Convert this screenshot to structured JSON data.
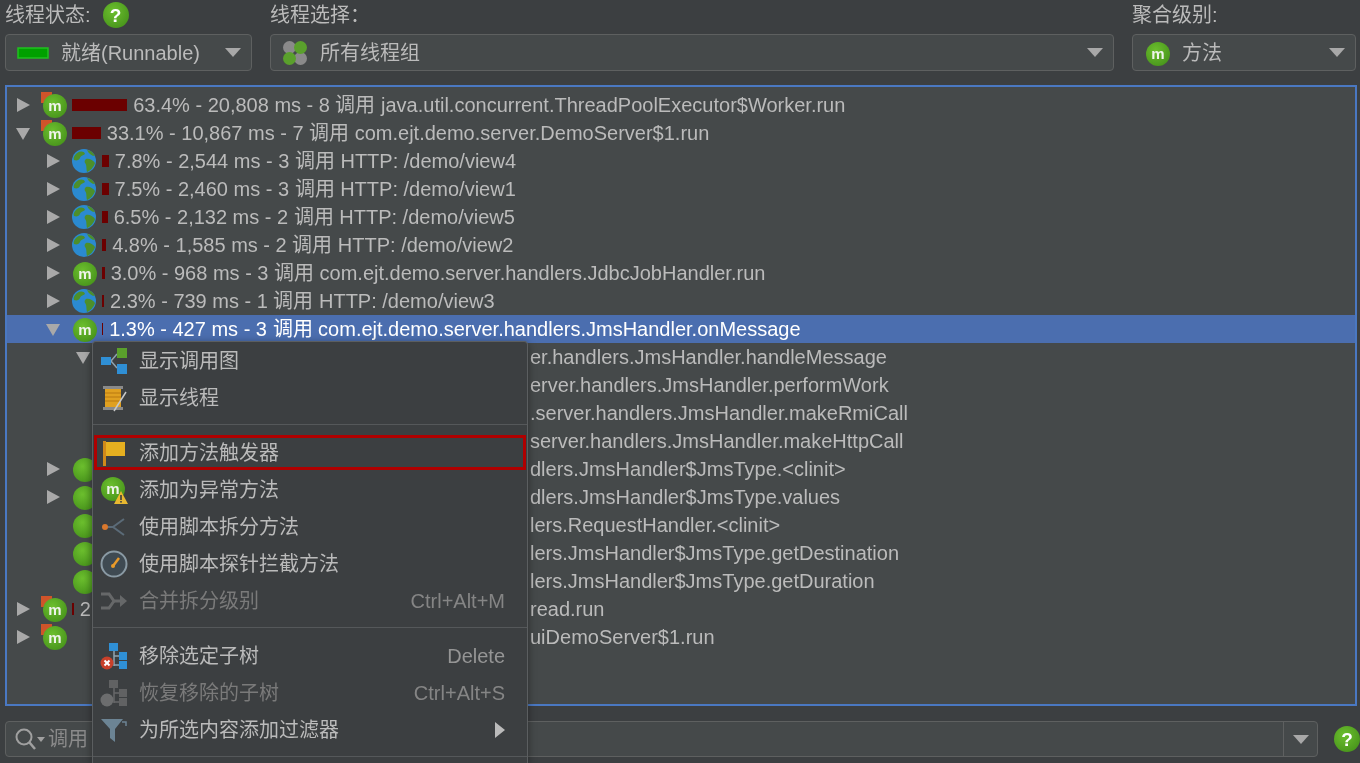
{
  "toolbar": {
    "thread_state": {
      "label": "线程状态:",
      "help": "?",
      "value": "就绪(Runnable)"
    },
    "thread_selection": {
      "label": "线程选择：",
      "value": "所有线程组"
    },
    "aggregation": {
      "label": "聚合级别:",
      "value": "方法",
      "glyph": "m"
    }
  },
  "tree": {
    "rows": [
      {
        "kind": "method",
        "glyph": "m",
        "marked": true,
        "expanded": false,
        "selected": false,
        "level": 0.634,
        "text": "63.4% - 20,808 ms - 8 调用 java.util.concurrent.ThreadPoolExecutor$Worker.run"
      },
      {
        "kind": "method",
        "glyph": "m",
        "marked": true,
        "expanded": true,
        "selected": false,
        "level": 0.331,
        "text": "33.1% - 10,867 ms - 7 调用 com.ejt.demo.server.DemoServer$1.run",
        "children": [
          {
            "kind": "http",
            "expanded": false,
            "selected": false,
            "level": 0.078,
            "text": "7.8% - 2,544 ms - 3 调用 HTTP: /demo/view4"
          },
          {
            "kind": "http",
            "expanded": false,
            "selected": false,
            "level": 0.075,
            "text": "7.5% - 2,460 ms - 3 调用 HTTP: /demo/view1"
          },
          {
            "kind": "http",
            "expanded": false,
            "selected": false,
            "level": 0.065,
            "text": "6.5% - 2,132 ms - 2 调用 HTTP: /demo/view5"
          },
          {
            "kind": "http",
            "expanded": false,
            "selected": false,
            "level": 0.048,
            "text": "4.8% - 1,585 ms - 2 调用 HTTP: /demo/view2"
          },
          {
            "kind": "method",
            "glyph": "m",
            "marked": false,
            "expanded": false,
            "selected": false,
            "level": 0.03,
            "text": "3.0% - 968 ms - 3 调用 com.ejt.demo.server.handlers.JdbcJobHandler.run"
          },
          {
            "kind": "http",
            "expanded": false,
            "selected": false,
            "level": 0.023,
            "text": "2.3% - 739 ms - 1 调用 HTTP: /demo/view3"
          },
          {
            "kind": "method",
            "glyph": "m",
            "marked": false,
            "expanded": true,
            "selected": true,
            "level": 0.013,
            "text": "1.3% - 427 ms - 3 调用 com.ejt.demo.server.handlers.JmsHandler.onMessage",
            "children": [
              {
                "expanded": true,
                "selected": false,
                "text_after": "er.handlers.JmsHandler.handleMessage",
                "children": [
                  {
                    "selected": false,
                    "text_after": "erver.handlers.JmsHandler.performWork"
                  },
                  {
                    "selected": false,
                    "text_after": ".server.handlers.JmsHandler.makeRmiCall"
                  },
                  {
                    "selected": false,
                    "text_after": "server.handlers.JmsHandler.makeHttpCall"
                  }
                ]
              }
            ]
          },
          {
            "kind": "method",
            "marked": false,
            "expanded": false,
            "selected": false,
            "text_after": "dlers.JmsHandler$JmsType.<clinit>"
          },
          {
            "kind": "method",
            "marked": false,
            "expanded": false,
            "selected": false,
            "text_after": "dlers.JmsHandler$JmsType.values"
          },
          {
            "kind": "method",
            "marked": false,
            "selected": false,
            "text_after": "lers.RequestHandler.<clinit>"
          },
          {
            "kind": "method",
            "marked": false,
            "selected": false,
            "text_after": "lers.JmsHandler$JmsType.getDestination"
          },
          {
            "kind": "method",
            "marked": false,
            "selected": false,
            "text_after": "lers.JmsHandler$JmsType.getDuration"
          }
        ]
      },
      {
        "kind": "method",
        "glyph": "m",
        "marked": true,
        "expanded": false,
        "selected": false,
        "level": 0.02,
        "text_before": "2",
        "text_after": "read.run"
      },
      {
        "kind": "method",
        "glyph": "m",
        "marked": true,
        "expanded": false,
        "selected": false,
        "text_after": "uiDemoServer$1.run"
      }
    ]
  },
  "context_menu": {
    "items": [
      {
        "kind": "item",
        "label": "显示调用图",
        "disabled": false,
        "highlighted": false,
        "submenu": false
      },
      {
        "kind": "item",
        "label": "显示线程",
        "disabled": false,
        "highlighted": false,
        "submenu": false
      },
      {
        "kind": "separator"
      },
      {
        "kind": "item",
        "label": "添加方法触发器",
        "disabled": false,
        "highlighted": true,
        "submenu": false
      },
      {
        "kind": "item",
        "label": "添加为异常方法",
        "glyph": "m",
        "disabled": false,
        "highlighted": false,
        "submenu": false
      },
      {
        "kind": "item",
        "label": "使用脚本拆分方法",
        "disabled": false,
        "highlighted": false,
        "submenu": false
      },
      {
        "kind": "item",
        "label": "使用脚本探针拦截方法",
        "disabled": false,
        "highlighted": false,
        "submenu": false
      },
      {
        "kind": "item",
        "label": "合并拆分级别",
        "shortcut": "Ctrl+Alt+M",
        "disabled": true,
        "highlighted": false,
        "submenu": false
      },
      {
        "kind": "separator"
      },
      {
        "kind": "item",
        "label": "移除选定子树",
        "shortcut": "Delete",
        "disabled": false,
        "highlighted": false,
        "submenu": false
      },
      {
        "kind": "item",
        "label": "恢复移除的子树",
        "shortcut": "Ctrl+Alt+S",
        "disabled": true,
        "highlighted": false,
        "submenu": false
      },
      {
        "kind": "item",
        "label": "为所选内容添加过滤器",
        "disabled": false,
        "highlighted": false,
        "submenu": true
      },
      {
        "kind": "separator"
      }
    ]
  },
  "search": {
    "placeholder": "调用",
    "help": "?"
  }
}
